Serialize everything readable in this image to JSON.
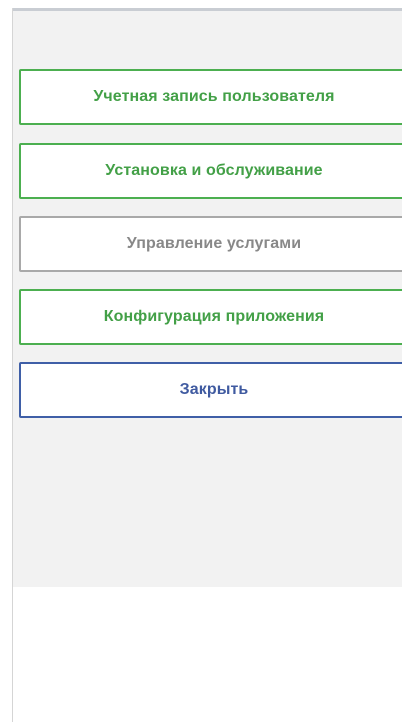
{
  "menu": {
    "items": [
      {
        "label": "Учетная запись пользователя",
        "accent": "#43a047"
      },
      {
        "label": "Установка и обслуживание",
        "accent": "#43a047"
      },
      {
        "label": "Управление услугами",
        "accent": "#888888",
        "state": "disabled"
      },
      {
        "label": "Конфигурация приложения",
        "accent": "#43a047"
      }
    ],
    "close_label": "Закрыть",
    "close_accent": "#3f5aa0"
  }
}
